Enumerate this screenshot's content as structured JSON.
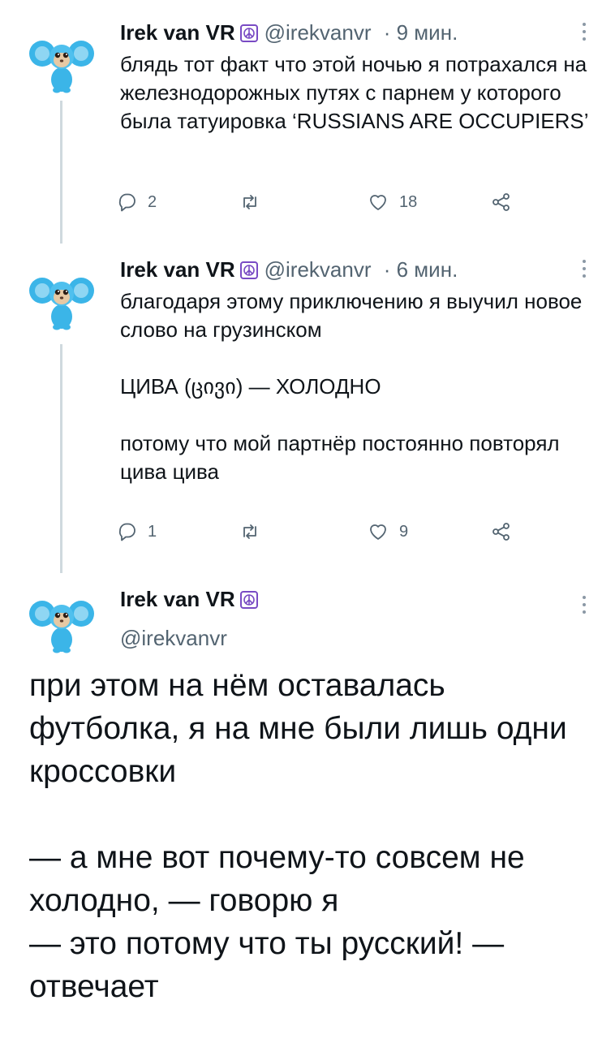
{
  "tweets": [
    {
      "name": "Irek van VR",
      "handle": "@irekvanvr",
      "time": "9 мин.",
      "text": "блядь тот факт что этой ночью я потрахался на железнодорожных путях с парнем у которого была татуировка ‘RUSSIANS ARE OCCUPIERS’",
      "replies": "2",
      "retweets": "",
      "likes": "18"
    },
    {
      "name": "Irek van VR",
      "handle": "@irekvanvr",
      "time": "6 мин.",
      "text": "благодаря этому приключению я выучил новое слово на грузинском\n\nЦИВА (ცივი) — ХОЛОДНО\n\nпотому что мой партнёр постоянно повторял цива цива",
      "replies": "1",
      "retweets": "",
      "likes": "9"
    }
  ],
  "main_tweet": {
    "name": "Irek van VR",
    "handle": "@irekvanvr",
    "text": "при этом на нём оставалась футболка, я на мне были лишь одни кроссовки\n\n— а мне вот почему-то совсем не холодно, — говорю я\n— это потому что ты русский! — отвечает"
  },
  "icons": {
    "reply": "reply-icon",
    "retweet": "retweet-icon",
    "like": "heart-icon",
    "share": "share-icon",
    "more": "more-icon",
    "badge": "peace-icon"
  },
  "colors": {
    "text": "#0f1419",
    "secondary": "#536471",
    "thread_line": "#cfd9de",
    "badge": "#794bc4",
    "avatar_fur": "#3bb5e8"
  }
}
